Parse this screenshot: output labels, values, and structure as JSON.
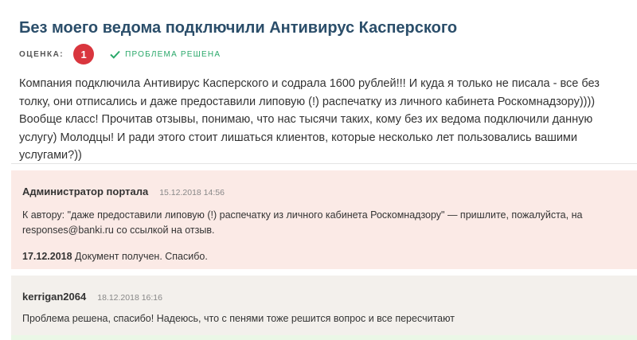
{
  "review": {
    "title": "Без моего ведома подключили Антивирус Касперского",
    "rating_label": "ОЦЕНКА:",
    "rating_value": "1",
    "status": "ПРОБЛЕМА РЕШЕНА",
    "status_icon": "check-icon",
    "text": "Компания подключила Антивирус Касперского и содрала 1600 рублей!!! И куда я только не писала - все без толку, они отписались и даже предоставили липовую (!) распечатку из личного кабинета Роскомнадзору)))) Вообще класс! Прочитав отзывы, понимаю, что нас тысячи таких, кому без их ведома подключили данную услугу) Молодцы! И ради этого стоит лишаться клиентов, которые несколько лет пользовались вашими услугами?))"
  },
  "comments": [
    {
      "author": "Администратор портала",
      "date": "15.12.2018 14:56",
      "text": "К автору: \"даже предоставили липовую (!) распечатку из личного кабинета Роскомнадзору\" — пришлите, пожалуйста, на responses@banki.ru со ссылкой на отзыв.",
      "note_date": "17.12.2018",
      "note_text": " Документ получен. Спасибо."
    },
    {
      "author": "kerrigan2064",
      "date": "18.12.2018 16:16",
      "text": "Проблема решена, спасибо! Надеюсь, что с пенями тоже решится вопрос и все пересчитают"
    }
  ],
  "colors": {
    "title": "#2b4e6a",
    "rating_badge": "#d9363e",
    "solved": "#2aa86a",
    "admin_bg": "#fbeae6",
    "user_bg": "#f3f0ec"
  }
}
